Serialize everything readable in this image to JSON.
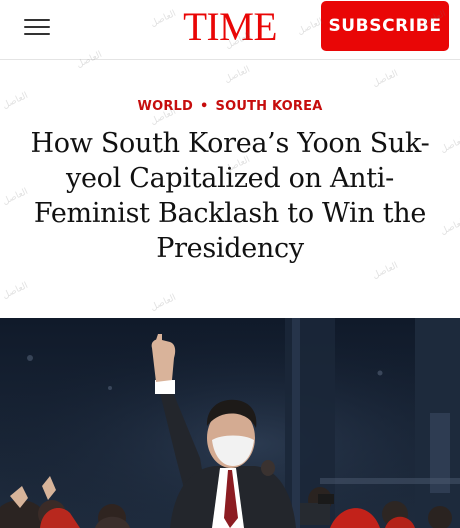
{
  "header": {
    "menu_icon": "hamburger-menu-icon",
    "logo": "TIME",
    "subscribe_label": "SUBSCRIBE"
  },
  "article": {
    "section": "WORLD",
    "subsection": "SOUTH KOREA",
    "separator": "•",
    "headline": "How South Korea’s Yoon Suk-yeol Capitalized on Anti-Feminist Backlash to Win the Presidency"
  },
  "watermark": "العاصل",
  "colors": {
    "brand_red": "#e90606",
    "kicker_red": "#c60d0d"
  }
}
